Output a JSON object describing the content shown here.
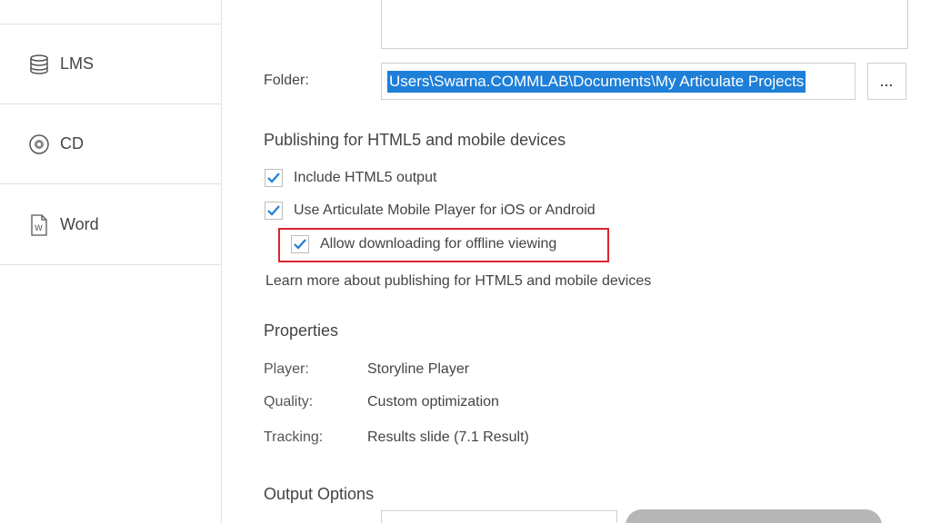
{
  "sidebar": {
    "items": [
      {
        "label": "LMS",
        "icon": "database-icon"
      },
      {
        "label": "CD",
        "icon": "disc-icon"
      },
      {
        "label": "Word",
        "icon": "word-document-icon"
      }
    ]
  },
  "folder": {
    "label": "Folder:",
    "value": "Users\\Swarna.COMMLAB\\Documents\\My Articulate Projects",
    "browse_label": "..."
  },
  "html5": {
    "title": "Publishing for HTML5 and mobile devices",
    "options": [
      {
        "label": "Include HTML5 output",
        "checked": true
      },
      {
        "label": "Use Articulate Mobile Player for iOS or Android",
        "checked": true
      },
      {
        "label": "Allow downloading for offline viewing",
        "checked": true
      }
    ],
    "learn_more": "Learn more about publishing for HTML5 and mobile devices"
  },
  "properties": {
    "title": "Properties",
    "rows": [
      {
        "label": "Player:",
        "value": "Storyline Player"
      },
      {
        "label": "Quality:",
        "value": "Custom optimization"
      },
      {
        "label": "Tracking:",
        "value": "Results slide (7.1 Result)"
      }
    ]
  },
  "output": {
    "title": "Output Options"
  },
  "colors": {
    "selection": "#1e7fd8",
    "checkmark": "#1e7fd8",
    "highlight": "#d9262b"
  }
}
